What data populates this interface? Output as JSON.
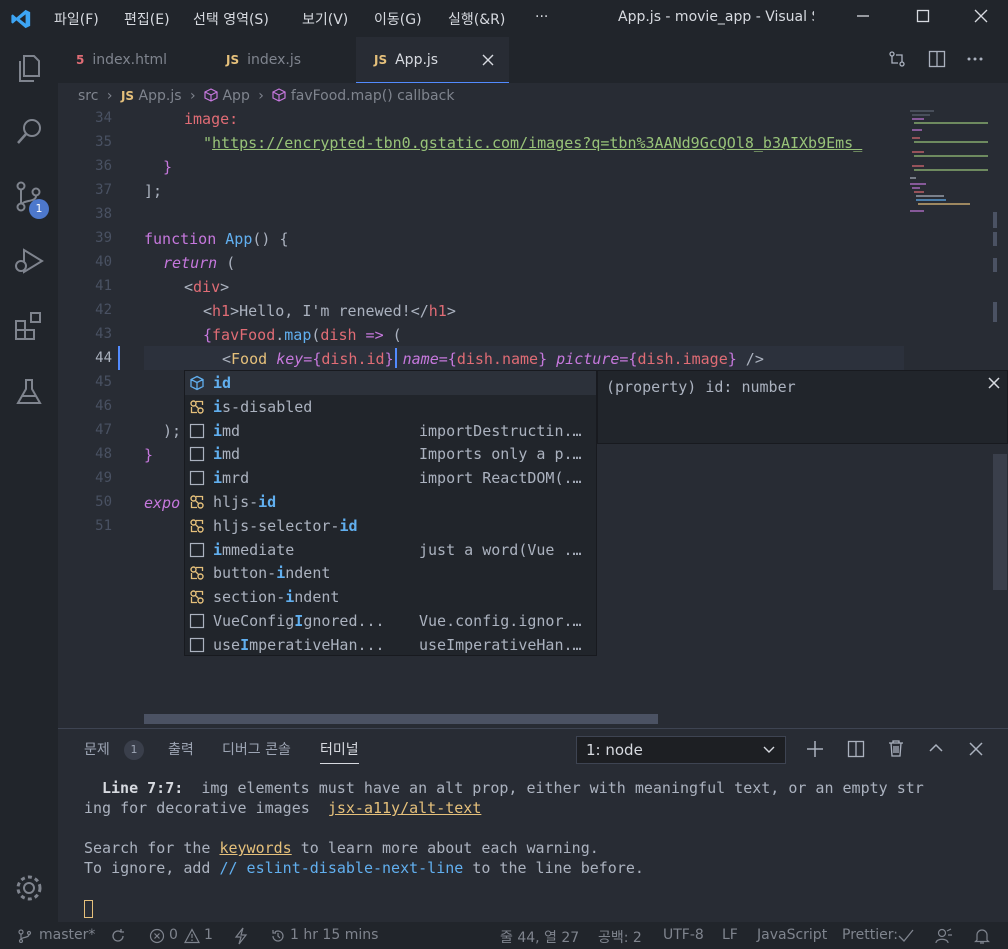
{
  "titlebar": {
    "menus": [
      "파일(F)",
      "편집(E)",
      "선택 영역(S)",
      "보기(V)",
      "이동(G)",
      "실행(&R)",
      "···"
    ],
    "title": "App.js - movie_app - Visual Stu..."
  },
  "activity": {
    "scm_badge": "1"
  },
  "tabs": [
    {
      "icon": "5",
      "label": "index.html"
    },
    {
      "icon": "JS",
      "label": "index.js"
    },
    {
      "icon": "JS",
      "label": "App.js"
    }
  ],
  "breadcrumb": {
    "src": "src",
    "file_icon": "JS",
    "file": "App.js",
    "component": "App",
    "callback": "favFood.map() callback"
  },
  "editor": {
    "line_numbers": [
      "34",
      "35",
      "36",
      "37",
      "38",
      "39",
      "40",
      "41",
      "42",
      "43",
      "44",
      "45",
      "46",
      "47",
      "48",
      "49",
      "50",
      "51"
    ],
    "code": {
      "l34_key": "image:",
      "l35_q": "\"",
      "l35_url": "https://encrypted-tbn0.gstatic.com/images?q=tbn%3AANd9GcQOl8_b3AIXb9Ems_",
      "l36": "}",
      "l37": "];",
      "l39_kw": "function",
      "l39_name": "App",
      "l39_rest": "() {",
      "l40_kw": "return",
      "l40_rest": " (",
      "l41_open": "<",
      "l41_tag": "div",
      "l41_close": ">",
      "l42_text": "Hello, I'm renewed!",
      "l43_var": "favFood",
      "l43_fn": "map",
      "l43_param": "dish",
      "l44_comp": "Food",
      "l44_attr1": "key",
      "l44_val1": "dish.id",
      "l44_attr2": "name",
      "l44_val2": "dish.name",
      "l44_attr3": "picture",
      "l44_val3": "dish.image",
      "l46": ");",
      "l48": "}",
      "l50": "expo"
    }
  },
  "suggest": {
    "items": [
      {
        "label": "id",
        "pre": "",
        "mid": "id",
        "post": "",
        "detail": ""
      },
      {
        "label": "is-disabled",
        "pre": "",
        "mid": "i",
        "post": "s-disabled",
        "detail": ""
      },
      {
        "label": "imd",
        "pre": "",
        "mid": "i",
        "post": "md",
        "detail": "importDestructin..."
      },
      {
        "label": "imd",
        "pre": "",
        "mid": "i",
        "post": "md",
        "detail": "Imports only a p..."
      },
      {
        "label": "imrd",
        "pre": "",
        "mid": "i",
        "post": "mrd",
        "detail": "import ReactDOM(..."
      },
      {
        "label": "hljs-id",
        "pre": "hljs-",
        "mid": "id",
        "post": "",
        "detail": ""
      },
      {
        "label": "hljs-selector-id",
        "pre": "hljs-selector-",
        "mid": "id",
        "post": "",
        "detail": ""
      },
      {
        "label": "immediate",
        "pre": "",
        "mid": "i",
        "post": "mmediate",
        "detail": "just a word(Vue ..."
      },
      {
        "label": "button-indent",
        "pre": "button-",
        "mid": "i",
        "post": "ndent",
        "detail": ""
      },
      {
        "label": "section-indent",
        "pre": "section-",
        "mid": "i",
        "post": "ndent",
        "detail": ""
      },
      {
        "label": "VueConfigIgnored...",
        "pre": "VueConfig",
        "mid": "I",
        "post": "gnored...",
        "detail": "Vue.config.ignor..."
      },
      {
        "label": "useImperativeHan...",
        "pre": "use",
        "mid": "I",
        "post": "mperativeHan...",
        "detail": "useImperativeHan..."
      }
    ],
    "details_text": "(property) id: number"
  },
  "panel": {
    "tabs": [
      "문제",
      "출력",
      "디버그 콘솔",
      "터미널"
    ],
    "problems_count": "1",
    "terminal_select": "1: node",
    "lines": {
      "l1_bold": "Line 7:7:",
      "l1_rest": "  img elements must have an alt prop, either with meaningful text, or an empty str",
      "l2_rest": "ing for decorative images  ",
      "l2_link": "jsx-a11y/alt-text",
      "l3_a": "Search for the ",
      "l3_kw": "keywords",
      "l3_b": " to learn more about each warning.",
      "l4_a": "To ignore, add ",
      "l4_kw": "// eslint-disable-next-line",
      "l4_b": " to the line before."
    }
  },
  "status": {
    "branch": "master*",
    "errors": "0",
    "warnings": "1",
    "time": "1 hr 15 mins",
    "position": "줄 44, 열 27",
    "spaces": "공백: 2",
    "encoding": "UTF-8",
    "eol": "LF",
    "language": "JavaScript",
    "prettier": "Prettier:"
  }
}
